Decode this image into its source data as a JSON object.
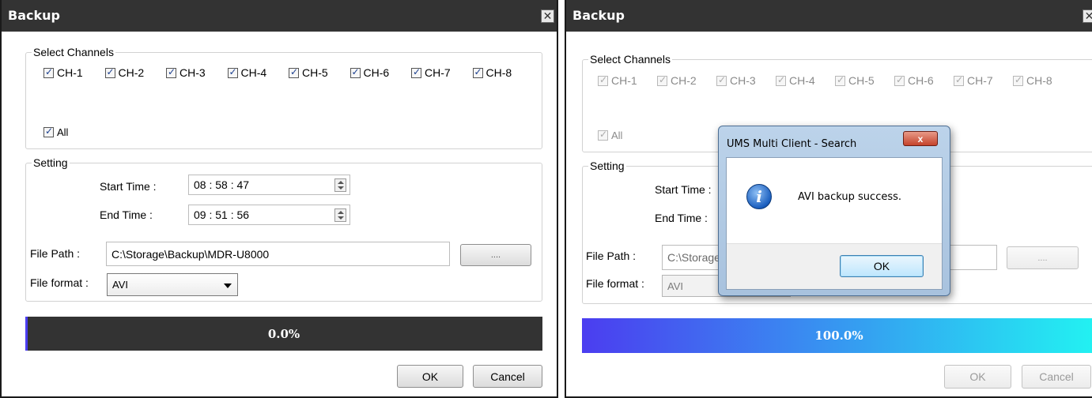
{
  "left_dialog": {
    "title": "Backup",
    "close_glyph": "✕",
    "channels_legend": "Select Channels",
    "channels": [
      "CH-1",
      "CH-2",
      "CH-3",
      "CH-4",
      "CH-5",
      "CH-6",
      "CH-7",
      "CH-8"
    ],
    "all_label": "All",
    "setting_legend": "Setting",
    "start_time_label": "Start Time :",
    "start_time_value": "08 : 58 : 47",
    "end_time_label": "End Time :",
    "end_time_value": "09 : 51 : 56",
    "file_path_label": "File Path :",
    "file_path_value": "C:\\Storage\\Backup\\MDR-U8000",
    "browse_label": "....",
    "file_format_label": "File format :",
    "file_format_value": "AVI",
    "progress_text": "0.0%",
    "progress_fraction": 0.0,
    "ok_label": "OK",
    "cancel_label": "Cancel"
  },
  "right_dialog": {
    "title": "Backup",
    "close_glyph": "✕",
    "channels_legend": "Select Channels",
    "channels": [
      "CH-1",
      "CH-2",
      "CH-3",
      "CH-4",
      "CH-5",
      "CH-6",
      "CH-7",
      "CH-8"
    ],
    "all_label": "All",
    "setting_legend": "Setting",
    "start_time_label": "Start Time :",
    "end_time_label": "End Time :",
    "file_path_label": "File Path :",
    "file_path_value": "C:\\Storage",
    "browse_label": "....",
    "file_format_label": "File format :",
    "file_format_value": "AVI",
    "progress_text": "100.0%",
    "progress_fraction": 1.0,
    "ok_label": "OK",
    "cancel_label": "Cancel"
  },
  "message_box": {
    "title": "UMS Multi Client - Search",
    "close_glyph": "x",
    "icon": "info-icon",
    "message": "AVI backup success.",
    "ok_label": "OK"
  },
  "colors": {
    "title_bar": "#333333",
    "progress_track_empty": "#333333",
    "progress_fill_start": "#4b3df0",
    "progress_fill_end": "#22f2f2",
    "progress_marker": "#4b3df0"
  }
}
